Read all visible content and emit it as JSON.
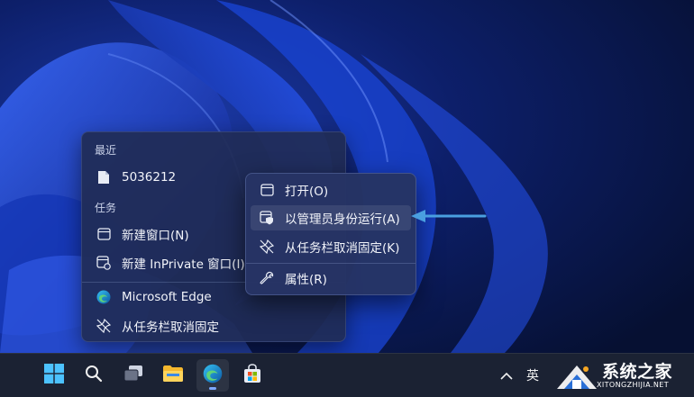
{
  "jumplist": {
    "recent_heading": "最近",
    "recent_items": [
      {
        "label": "5036212",
        "icon": "file-icon"
      }
    ],
    "tasks_heading": "任务",
    "task_items": [
      {
        "label": "新建窗口(N)",
        "icon": "window-icon"
      },
      {
        "label": "新建 InPrivate 窗口(I)",
        "icon": "inprivate-window-icon"
      }
    ],
    "app_items": [
      {
        "label": "Microsoft Edge",
        "icon": "edge-icon"
      },
      {
        "label": "从任务栏取消固定",
        "icon": "unpin-icon"
      }
    ]
  },
  "context_menu": {
    "items": [
      {
        "label": "打开(O)",
        "icon": "window-icon"
      },
      {
        "label": "以管理员身份运行(A)",
        "icon": "run-as-admin-shield-icon",
        "highlighted": true
      },
      {
        "label": "从任务栏取消固定(K)",
        "icon": "unpin-icon"
      },
      {
        "label": "属性(R)",
        "icon": "wrench-icon"
      }
    ]
  },
  "taskbar": {
    "buttons": [
      {
        "name": "start",
        "icon": "windows-start-icon"
      },
      {
        "name": "search",
        "icon": "search-icon"
      },
      {
        "name": "task-view",
        "icon": "task-view-icon"
      },
      {
        "name": "file-explorer",
        "icon": "folder-icon"
      },
      {
        "name": "edge",
        "icon": "edge-icon",
        "active": true
      },
      {
        "name": "store",
        "icon": "store-icon"
      }
    ],
    "tray_chevron_icon": "chevron-up-icon",
    "ime_indicator": "英"
  },
  "watermark": {
    "text": "系统之家",
    "subtext": "XITONGZHIJIA.NET"
  },
  "colors": {
    "accent_arrow": "#4a9fe0",
    "menu_bg": "#26346a",
    "taskbar_bg": "#1b2233"
  }
}
